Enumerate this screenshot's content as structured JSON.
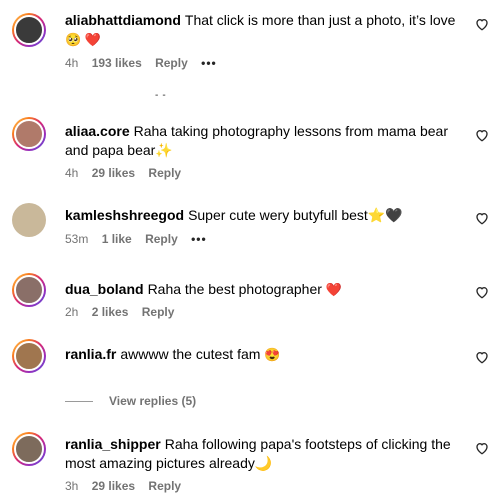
{
  "comments": [
    {
      "user": "aliabhattdiamond",
      "text": "That click is more than just a photo, it’s love",
      "emoji_line": "🥺 ❤️",
      "time": "4h",
      "likes": "193 likes",
      "reply": "Reply",
      "more": "•••"
    },
    {
      "user": "aliaa.core",
      "text": "Raha taking photography lessons from mama bear and papa bear✨",
      "time": "4h",
      "likes": "29 likes",
      "reply": "Reply"
    },
    {
      "user": "kamleshshreegod",
      "text": "Super cute wery butyfull best⭐🖤",
      "time": "53m",
      "likes": "1 like",
      "reply": "Reply",
      "more": "•••"
    },
    {
      "user": "dua_boland",
      "text": "Raha the best photographer",
      "emoji": "❤️",
      "time": "2h",
      "likes": "2 likes",
      "reply": "Reply"
    },
    {
      "user": "ranlia.fr",
      "text": "awwww the cutest fam",
      "emoji": "😍"
    },
    {
      "user": "ranlia_shipper",
      "text": "Raha following papa's footsteps of clicking the most amazing pictures already🌙",
      "time": "3h",
      "likes": "29 likes",
      "reply": "Reply"
    }
  ],
  "view_replies": "View replies (5)",
  "colors": {
    "muted": "#737373",
    "heart": "#ed1c24",
    "ring_gradient": "instagram"
  },
  "icons": {
    "like": "heart-outline-icon"
  }
}
